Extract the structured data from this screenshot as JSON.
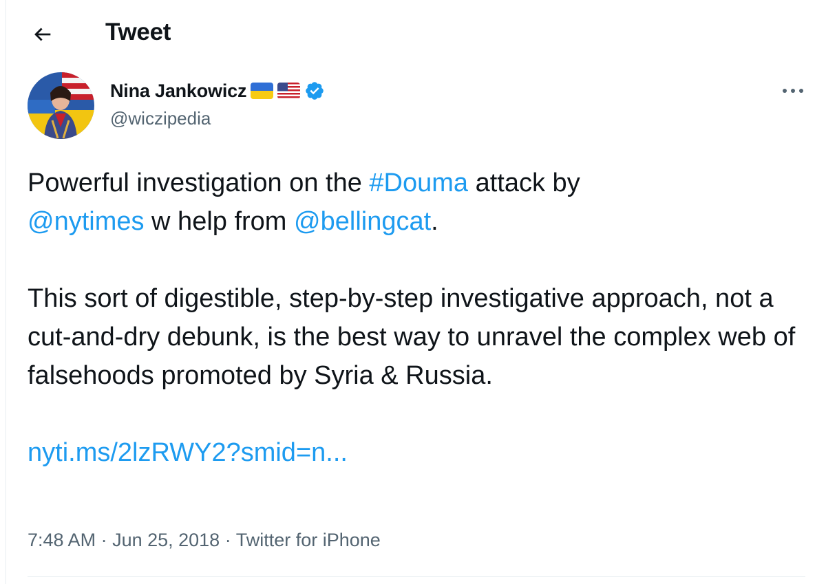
{
  "header": {
    "back_icon": "arrow-left-icon",
    "title": "Tweet"
  },
  "author": {
    "display_name": "Nina Jankowicz",
    "flags": [
      "ukraine-flag-icon",
      "usa-flag-icon"
    ],
    "verified_icon": "verified-badge-icon",
    "handle": "@wiczipedia",
    "more_icon": "more-horizontal-icon"
  },
  "tweet": {
    "para1_part1": "Powerful investigation on the ",
    "hashtag": "#Douma",
    "para1_part2": " attack by",
    "mention1": "@nytimes",
    "para1_part3": " w help from ",
    "mention2": "@bellingcat",
    "para1_part4": ".",
    "para2": "This sort of digestible, step-by-step investigative approach, not a cut-and-dry debunk, is the best way to unravel the complex web of falsehoods promoted by Syria & Russia.",
    "link": "nyti.ms/2lzRWY2?smid=n..."
  },
  "meta": {
    "time": "7:48 AM",
    "sep1": " · ",
    "date": "Jun 25, 2018",
    "sep2": " · ",
    "source": "Twitter for iPhone"
  },
  "colors": {
    "link": "#1d9bf0",
    "secondary_text": "#536471",
    "primary_text": "#0f1419",
    "divider": "#e6ecf0"
  }
}
